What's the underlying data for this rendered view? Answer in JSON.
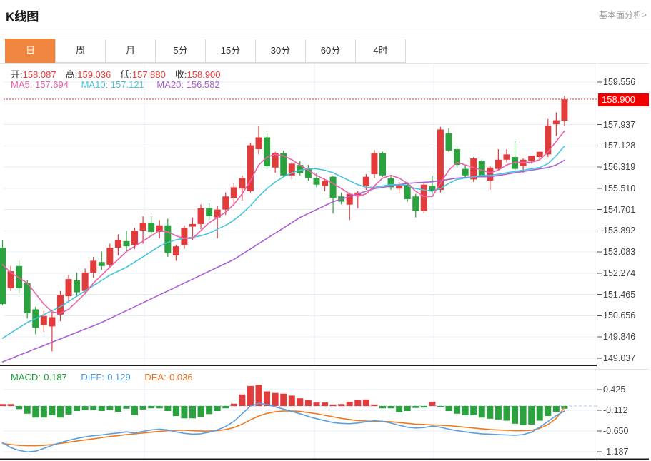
{
  "header": {
    "title": "K线图",
    "link": "基本面分析>"
  },
  "tabs": {
    "items": [
      {
        "label": "日",
        "active": true
      },
      {
        "label": "周",
        "active": false
      },
      {
        "label": "月",
        "active": false
      },
      {
        "label": "5分",
        "active": false
      },
      {
        "label": "15分",
        "active": false
      },
      {
        "label": "30分",
        "active": false
      },
      {
        "label": "60分",
        "active": false
      },
      {
        "label": "4时",
        "active": false
      }
    ]
  },
  "legend": {
    "ohlc": [
      {
        "label": "开:",
        "value": "158.087"
      },
      {
        "label": "高:",
        "value": "159.036"
      },
      {
        "label": "低:",
        "value": "157.880"
      },
      {
        "label": "收:",
        "value": "158.900"
      }
    ],
    "ma": [
      {
        "label": "MA5:",
        "value": "157.694"
      },
      {
        "label": "MA10:",
        "value": "157.121"
      },
      {
        "label": "MA20:",
        "value": "156.582"
      }
    ],
    "macd": [
      {
        "label": "MACD:",
        "value": "-0.187"
      },
      {
        "label": "DIFF:",
        "value": "-0.129"
      },
      {
        "label": "DEA:",
        "value": "-0.036"
      }
    ]
  },
  "chart_data": {
    "type": "candlestick+macd",
    "main": {
      "title": "K线图 daily candlesticks",
      "y_axis_labels": [
        "159.556",
        "157.937",
        "157.128",
        "156.319",
        "155.510",
        "154.701",
        "153.892",
        "153.083",
        "152.274",
        "151.465",
        "150.656",
        "149.846",
        "149.037"
      ],
      "y_top_value": 159.556,
      "y_bottom_value": 149.037,
      "last_price": 158.9,
      "last_price_label": "158.900",
      "price_line_value": 158.9,
      "candles_ohlc": [
        [
          153.25,
          153.55,
          151.05,
          151.1
        ],
        [
          151.7,
          152.55,
          151.6,
          152.35
        ],
        [
          152.55,
          152.75,
          151.5,
          151.7
        ],
        [
          151.9,
          152.0,
          150.55,
          150.75
        ],
        [
          150.9,
          151.0,
          149.95,
          150.2
        ],
        [
          150.3,
          150.85,
          150.05,
          150.65
        ],
        [
          150.25,
          150.8,
          149.3,
          150.6
        ],
        [
          150.7,
          151.6,
          150.45,
          151.45
        ],
        [
          151.4,
          152.2,
          151.2,
          152.05
        ],
        [
          152.0,
          152.3,
          151.4,
          151.55
        ],
        [
          151.6,
          152.45,
          151.5,
          152.3
        ],
        [
          152.3,
          152.9,
          152.1,
          152.75
        ],
        [
          152.7,
          153.1,
          152.4,
          152.55
        ],
        [
          152.6,
          153.4,
          152.5,
          153.25
        ],
        [
          153.25,
          153.75,
          152.95,
          153.55
        ],
        [
          153.5,
          153.9,
          153.1,
          153.3
        ],
        [
          153.35,
          154.0,
          153.2,
          153.9
        ],
        [
          153.9,
          154.45,
          153.4,
          154.2
        ],
        [
          154.2,
          154.45,
          153.7,
          153.85
        ],
        [
          153.85,
          154.3,
          153.6,
          154.1
        ],
        [
          154.1,
          154.35,
          152.9,
          153.05
        ],
        [
          152.95,
          153.35,
          152.75,
          153.3
        ],
        [
          153.35,
          154.1,
          153.2,
          154.0
        ],
        [
          154.05,
          154.4,
          153.55,
          154.15
        ],
        [
          154.15,
          154.9,
          153.95,
          154.75
        ],
        [
          154.75,
          154.95,
          154.3,
          154.45
        ],
        [
          154.4,
          154.85,
          153.6,
          154.7
        ],
        [
          154.7,
          155.35,
          154.5,
          155.2
        ],
        [
          155.15,
          155.7,
          154.85,
          155.55
        ],
        [
          155.5,
          156.0,
          155.05,
          155.9
        ],
        [
          155.4,
          157.25,
          155.35,
          157.15
        ],
        [
          157.0,
          157.9,
          156.8,
          157.45
        ],
        [
          157.45,
          157.6,
          156.25,
          156.35
        ],
        [
          156.3,
          156.9,
          156.1,
          156.85
        ],
        [
          156.85,
          156.95,
          155.95,
          156.0
        ],
        [
          156.0,
          156.5,
          155.85,
          156.45
        ],
        [
          156.4,
          156.55,
          156.0,
          156.1
        ],
        [
          156.25,
          156.4,
          155.8,
          155.9
        ],
        [
          155.9,
          156.1,
          155.55,
          155.65
        ],
        [
          155.6,
          155.85,
          155.4,
          155.8
        ],
        [
          155.95,
          156.0,
          154.55,
          155.15
        ],
        [
          155.2,
          155.35,
          154.9,
          155.0
        ],
        [
          154.89,
          155.35,
          154.3,
          155.3
        ],
        [
          155.25,
          155.4,
          154.75,
          155.35
        ],
        [
          155.6,
          156.05,
          155.45,
          155.95
        ],
        [
          156.05,
          156.97,
          155.9,
          156.85
        ],
        [
          156.85,
          156.9,
          155.95,
          156.0
        ],
        [
          155.9,
          156.0,
          155.45,
          155.55
        ],
        [
          155.5,
          155.75,
          155.3,
          155.65
        ],
        [
          155.65,
          155.75,
          155.0,
          155.1
        ],
        [
          155.2,
          155.3,
          154.4,
          154.65
        ],
        [
          154.65,
          155.7,
          154.55,
          155.65
        ],
        [
          155.6,
          156.0,
          155.3,
          155.4
        ],
        [
          155.45,
          157.85,
          155.35,
          157.75
        ],
        [
          157.6,
          157.8,
          156.9,
          156.95
        ],
        [
          157.0,
          157.1,
          156.3,
          156.4
        ],
        [
          156.25,
          156.4,
          155.9,
          156.0
        ],
        [
          155.85,
          156.7,
          155.75,
          156.65
        ],
        [
          156.55,
          156.6,
          155.95,
          156.0
        ],
        [
          155.8,
          156.35,
          155.45,
          156.3
        ],
        [
          156.25,
          157.0,
          156.2,
          156.6
        ],
        [
          156.6,
          157.0,
          156.5,
          156.8
        ],
        [
          156.7,
          157.3,
          156.2,
          156.25
        ],
        [
          156.35,
          156.65,
          156.1,
          156.6
        ],
        [
          156.55,
          156.75,
          156.45,
          156.75
        ],
        [
          156.7,
          156.9,
          156.6,
          156.9
        ],
        [
          156.8,
          158.15,
          156.7,
          157.9
        ],
        [
          157.95,
          158.4,
          157.5,
          158.1
        ],
        [
          158.087,
          159.036,
          157.88,
          158.9
        ]
      ],
      "ma5": [
        152.6,
        152.3,
        152.1,
        151.9,
        151.5,
        151.1,
        150.8,
        150.75,
        150.9,
        151.2,
        151.5,
        151.9,
        152.2,
        152.5,
        152.8,
        153.1,
        153.3,
        153.5,
        153.7,
        153.9,
        153.85,
        153.7,
        153.6,
        153.6,
        153.9,
        154.2,
        154.4,
        154.6,
        154.9,
        155.3,
        155.8,
        156.4,
        156.7,
        156.8,
        156.75,
        156.6,
        156.4,
        156.2,
        156.0,
        155.85,
        155.7,
        155.5,
        155.3,
        155.2,
        155.3,
        155.6,
        155.9,
        156.0,
        155.9,
        155.7,
        155.4,
        155.2,
        155.2,
        155.7,
        156.2,
        156.5,
        156.4,
        156.3,
        156.2,
        156.1,
        156.2,
        156.4,
        156.5,
        156.5,
        156.5,
        156.6,
        156.9,
        157.3,
        157.694
      ],
      "ma10": [
        149.8,
        150.0,
        150.2,
        150.4,
        150.55,
        150.7,
        150.85,
        151.0,
        151.2,
        151.4,
        151.6,
        151.8,
        152.0,
        152.2,
        152.35,
        152.5,
        152.7,
        152.9,
        153.1,
        153.3,
        153.45,
        153.55,
        153.6,
        153.65,
        153.7,
        153.8,
        153.95,
        154.1,
        154.3,
        154.55,
        154.85,
        155.2,
        155.5,
        155.75,
        155.95,
        156.1,
        156.2,
        156.25,
        156.25,
        156.2,
        156.1,
        155.95,
        155.8,
        155.65,
        155.55,
        155.55,
        155.6,
        155.65,
        155.65,
        155.6,
        155.5,
        155.45,
        155.4,
        155.5,
        155.7,
        155.85,
        155.9,
        155.95,
        156.0,
        156.0,
        156.05,
        156.1,
        156.15,
        156.2,
        156.25,
        156.3,
        156.45,
        156.75,
        157.121
      ],
      "ma20": [
        148.9,
        149.02,
        149.15,
        149.27,
        149.4,
        149.52,
        149.65,
        149.77,
        149.9,
        150.02,
        150.15,
        150.27,
        150.4,
        150.55,
        150.7,
        150.85,
        151.0,
        151.15,
        151.3,
        151.45,
        151.6,
        151.75,
        151.9,
        152.05,
        152.2,
        152.35,
        152.5,
        152.65,
        152.8,
        153.0,
        153.2,
        153.4,
        153.6,
        153.8,
        154.0,
        154.2,
        154.4,
        154.55,
        154.7,
        154.85,
        155.0,
        155.1,
        155.2,
        155.3,
        155.4,
        155.5,
        155.55,
        155.6,
        155.65,
        155.7,
        155.72,
        155.74,
        155.76,
        155.8,
        155.85,
        155.9,
        155.92,
        155.95,
        155.95,
        155.95,
        156.0,
        156.05,
        156.1,
        156.15,
        156.2,
        156.25,
        156.3,
        156.4,
        156.582
      ]
    },
    "macd": {
      "y_axis_labels": [
        "0.425",
        "-0.112",
        "-0.650",
        "-1.187"
      ],
      "hist": [
        0.05,
        0.05,
        -0.08,
        -0.2,
        -0.3,
        -0.3,
        -0.24,
        -0.3,
        -0.22,
        -0.13,
        -0.1,
        -0.1,
        -0.13,
        -0.1,
        -0.15,
        -0.07,
        -0.24,
        -0.09,
        -0.06,
        -0.06,
        -0.13,
        -0.26,
        -0.32,
        -0.32,
        -0.28,
        -0.21,
        -0.13,
        -0.06,
        0.06,
        0.3,
        0.52,
        0.55,
        0.38,
        0.34,
        0.32,
        0.27,
        0.2,
        0.16,
        0.09,
        0.09,
        0.04,
        0.05,
        0.11,
        0.16,
        0.17,
        0.04,
        -0.06,
        -0.06,
        -0.16,
        -0.13,
        -0.05,
        -0.04,
        0.11,
        -0.03,
        -0.13,
        -0.2,
        -0.24,
        -0.24,
        -0.3,
        -0.33,
        -0.35,
        -0.38,
        -0.46,
        -0.5,
        -0.48,
        -0.38,
        -0.26,
        -0.15,
        -0.07
      ],
      "diff": [
        -0.95,
        -1.08,
        -1.15,
        -1.19,
        -1.17,
        -1.1,
        -1.02,
        -0.95,
        -0.89,
        -0.84,
        -0.8,
        -0.77,
        -0.75,
        -0.72,
        -0.7,
        -0.67,
        -0.7,
        -0.66,
        -0.62,
        -0.6,
        -0.62,
        -0.67,
        -0.71,
        -0.73,
        -0.72,
        -0.68,
        -0.62,
        -0.53,
        -0.4,
        -0.2,
        0.0,
        0.07,
        0.04,
        -0.02,
        -0.08,
        -0.14,
        -0.2,
        -0.27,
        -0.33,
        -0.38,
        -0.43,
        -0.45,
        -0.46,
        -0.44,
        -0.41,
        -0.38,
        -0.4,
        -0.44,
        -0.5,
        -0.55,
        -0.57,
        -0.56,
        -0.52,
        -0.55,
        -0.6,
        -0.64,
        -0.67,
        -0.7,
        -0.72,
        -0.73,
        -0.74,
        -0.75,
        -0.76,
        -0.74,
        -0.68,
        -0.55,
        -0.4,
        -0.25,
        -0.129
      ],
      "dea": [
        -0.97,
        -1.0,
        -1.02,
        -1.03,
        -1.03,
        -1.02,
        -1.0,
        -0.97,
        -0.94,
        -0.91,
        -0.88,
        -0.85,
        -0.82,
        -0.79,
        -0.77,
        -0.74,
        -0.72,
        -0.7,
        -0.68,
        -0.66,
        -0.64,
        -0.63,
        -0.63,
        -0.64,
        -0.65,
        -0.65,
        -0.64,
        -0.61,
        -0.56,
        -0.47,
        -0.36,
        -0.26,
        -0.19,
        -0.15,
        -0.13,
        -0.13,
        -0.14,
        -0.17,
        -0.2,
        -0.24,
        -0.28,
        -0.32,
        -0.35,
        -0.38,
        -0.39,
        -0.4,
        -0.4,
        -0.41,
        -0.43,
        -0.45,
        -0.47,
        -0.48,
        -0.49,
        -0.5,
        -0.51,
        -0.53,
        -0.55,
        -0.57,
        -0.59,
        -0.61,
        -0.62,
        -0.63,
        -0.64,
        -0.64,
        -0.63,
        -0.58,
        -0.48,
        -0.32,
        -0.036
      ]
    },
    "colors": {
      "up": "#e23b3b",
      "down": "#2aa23d",
      "ma5": "#ee5fa7",
      "ma10": "#45c5dc",
      "ma20": "#aa5fd3",
      "diff": "#5b9fe0",
      "dea": "#f0791f",
      "grid": "#e7edf4",
      "axis": "#333333",
      "price_line": "#f3302c",
      "zero_line": "#aac8e6",
      "badge_bg": "#f20000",
      "tab_active_bg": "#f0863f",
      "value_red": "#f23b3b"
    }
  }
}
